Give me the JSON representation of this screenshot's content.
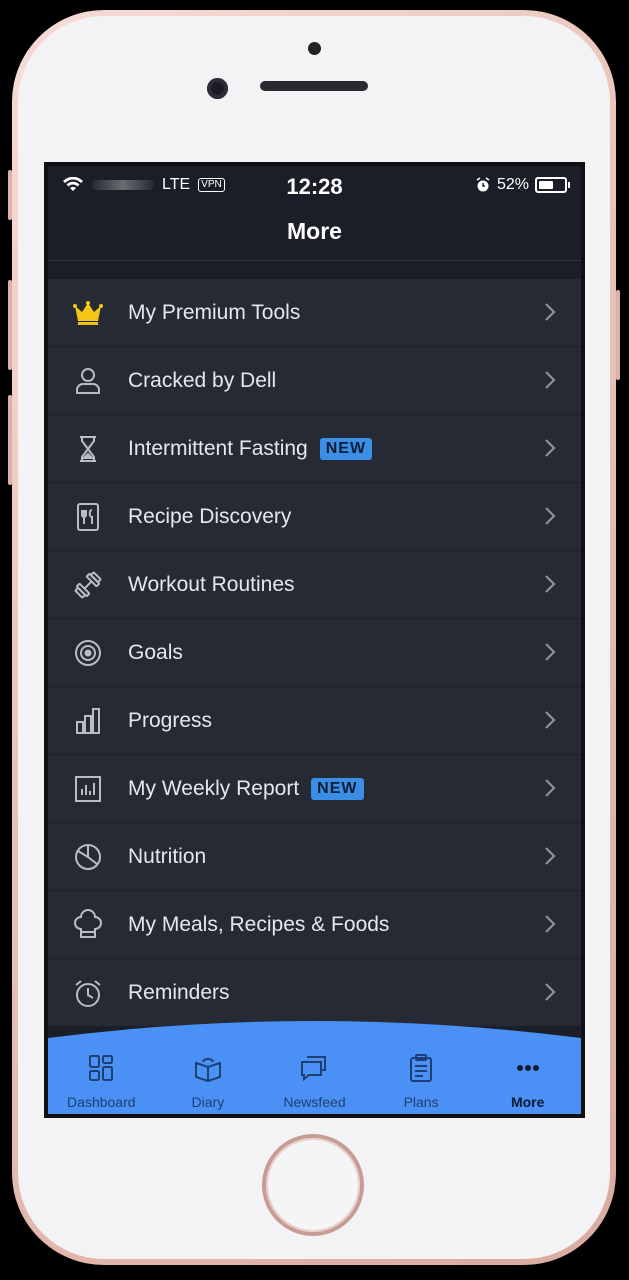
{
  "status_bar": {
    "network": "LTE",
    "vpn": "VPN",
    "time": "12:28",
    "battery": "52%"
  },
  "nav": {
    "title": "More"
  },
  "menu": [
    {
      "label": "My Premium Tools",
      "icon": "crown-icon",
      "badge": ""
    },
    {
      "label": "Cracked by Dell",
      "icon": "user-icon",
      "badge": ""
    },
    {
      "label": "Intermittent Fasting",
      "icon": "hourglass-icon",
      "badge": "NEW"
    },
    {
      "label": "Recipe Discovery",
      "icon": "recipe-book-icon",
      "badge": ""
    },
    {
      "label": "Workout Routines",
      "icon": "dumbbell-icon",
      "badge": ""
    },
    {
      "label": "Goals",
      "icon": "target-icon",
      "badge": ""
    },
    {
      "label": "Progress",
      "icon": "bar-chart-icon",
      "badge": ""
    },
    {
      "label": "My Weekly Report",
      "icon": "report-icon",
      "badge": "NEW"
    },
    {
      "label": "Nutrition",
      "icon": "pie-chart-icon",
      "badge": ""
    },
    {
      "label": "My Meals, Recipes & Foods",
      "icon": "chef-hat-icon",
      "badge": ""
    },
    {
      "label": "Reminders",
      "icon": "alarm-clock-icon",
      "badge": ""
    }
  ],
  "tabbar": {
    "tabs": [
      {
        "label": "Dashboard",
        "icon": "dashboard-icon",
        "active": false
      },
      {
        "label": "Diary",
        "icon": "diary-icon",
        "active": false
      },
      {
        "label": "Newsfeed",
        "icon": "newsfeed-icon",
        "active": false
      },
      {
        "label": "Plans",
        "icon": "clipboard-icon",
        "active": false
      },
      {
        "label": "More",
        "icon": "more-dots-icon",
        "active": true
      }
    ]
  },
  "colors": {
    "accent": "#4a90f5",
    "badge": "#3a8ee6",
    "background": "#1b1e26",
    "row": "#262a35",
    "crown": "#f5c518"
  }
}
